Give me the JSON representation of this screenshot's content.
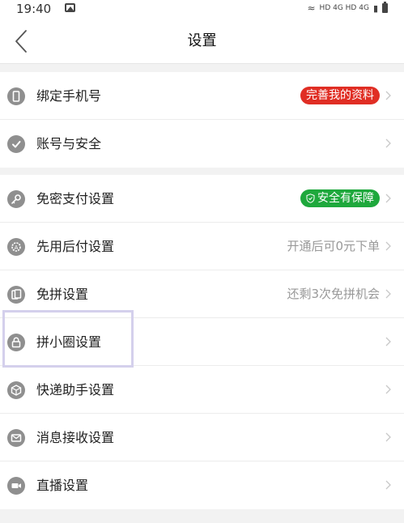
{
  "status_bar": {
    "time": "19:40",
    "network_text": "HD 4G HD 4G",
    "icons": [
      "gallery-icon",
      "wifi-icon",
      "signal-icon",
      "battery-icon"
    ]
  },
  "nav": {
    "title": "设置",
    "back_icon": "chevron-left-icon"
  },
  "groups": [
    {
      "items": [
        {
          "label": "绑定手机号",
          "icon": "phone-icon",
          "badge": "完善我的资料",
          "badge_color": "#e02e24"
        },
        {
          "label": "账号与安全",
          "icon": "check-shield-icon"
        }
      ]
    },
    {
      "items": [
        {
          "label": "免密支付设置",
          "icon": "key-icon",
          "badge": "安全有保障",
          "badge_color": "#1ea83c"
        },
        {
          "label": "先用后付设置",
          "icon": "gear-badge-icon",
          "value": "开通后可0元下单"
        },
        {
          "label": "免拼设置",
          "icon": "cards-icon",
          "value": "还剩3次免拼机会"
        },
        {
          "label": "拼小圈设置",
          "icon": "lock-icon"
        },
        {
          "label": "快递助手设置",
          "icon": "package-icon"
        },
        {
          "label": "消息接收设置",
          "icon": "envelope-icon"
        },
        {
          "label": "直播设置",
          "icon": "video-camera-icon"
        }
      ]
    }
  ],
  "colors": {
    "accent_red": "#e02e24",
    "accent_green": "#1ea83c",
    "icon_gray": "#8f8f8f",
    "background": "#f2f2f2"
  }
}
